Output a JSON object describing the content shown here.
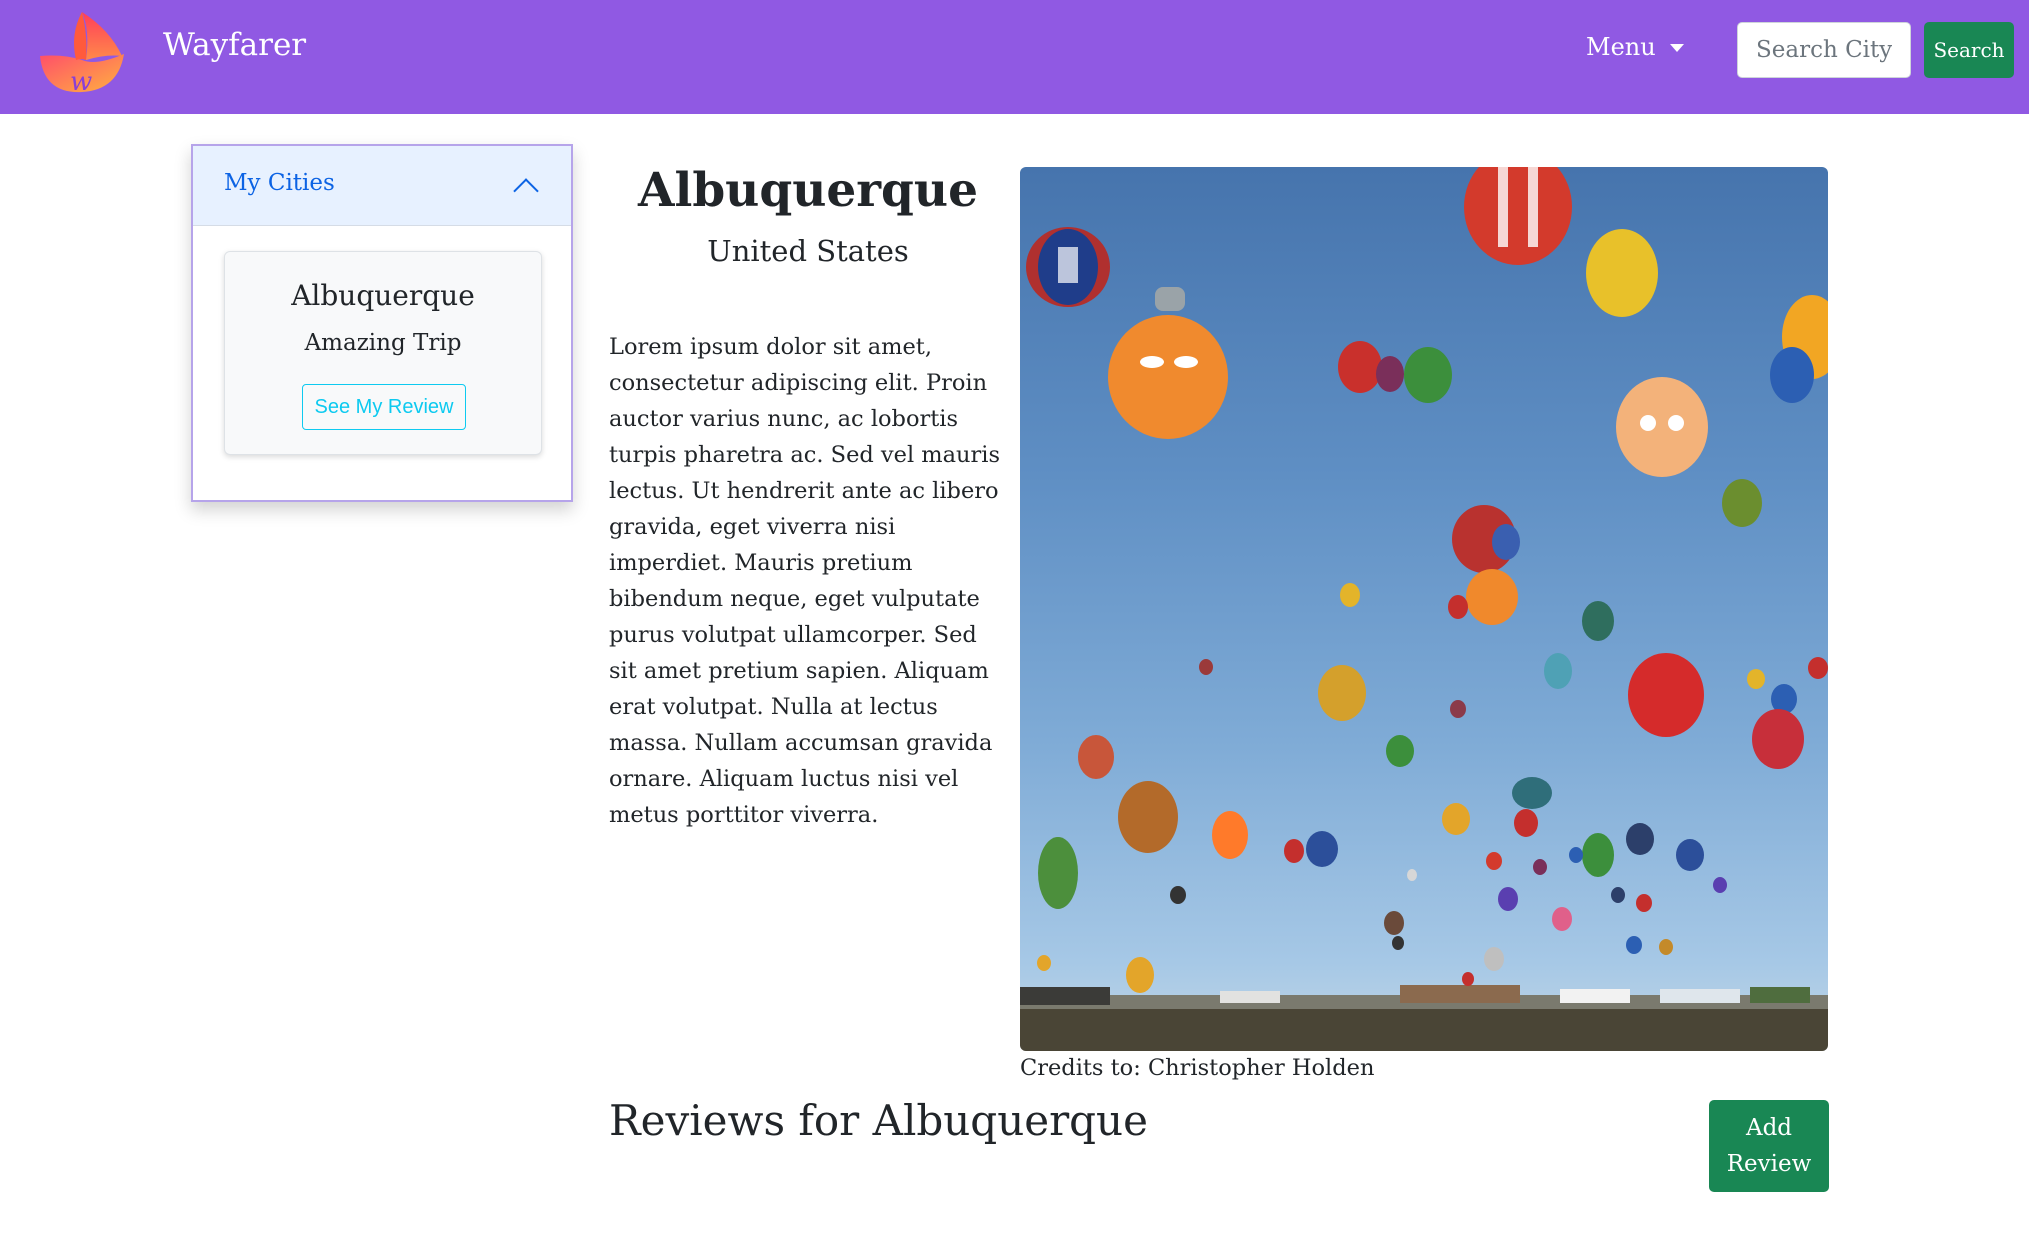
{
  "navbar": {
    "brand": "Wayfarer",
    "logo_icon": "wayfarer-logo-icon",
    "menu_label": "Menu",
    "search_placeholder": "Search City",
    "search_button": "Search",
    "color": "#9059e3"
  },
  "sidebar": {
    "title": "My Cities",
    "cities": [
      {
        "name": "Albuquerque",
        "subtitle": "Amazing Trip",
        "button": "See My Review"
      }
    ]
  },
  "city": {
    "name": "Albuquerque",
    "country": "United States",
    "description": "Lorem ipsum dolor sit amet, consectetur adipiscing elit. Proin auctor varius nunc, ac lobortis turpis pharetra ac. Sed vel mauris lectus. Ut hendrerit ante ac libero gravida, eget viverra nisi imperdiet. Mauris pretium bibendum neque, eget vulputate purus volutpat ullamcorper. Sed sit amet pretium sapien. Aliquam erat volutpat. Nulla at lectus massa. Nullam accumsan gravida ornare. Aliquam luctus nisi vel metus porttitor viverra.",
    "photo_credit": "Credits to: Christopher Holden"
  },
  "reviews": {
    "heading": "Reviews for Albuquerque",
    "add_button": "Add Review"
  },
  "colors": {
    "accent": "#9059e3",
    "success": "#198754",
    "info": "#0dcaf0",
    "accordion_header": "#e7f1ff"
  }
}
